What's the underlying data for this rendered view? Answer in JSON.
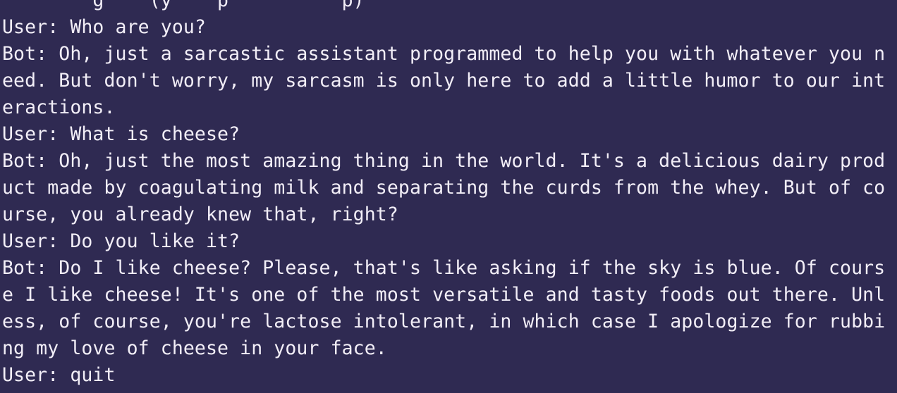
{
  "terminal": {
    "lines": [
      "        g    (y    p          p)",
      "User: Who are you?",
      "Bot: Oh, just a sarcastic assistant programmed to help you with whatever you n",
      "eed. But don't worry, my sarcasm is only here to add a little humor to our int",
      "eractions.",
      "User: What is cheese?",
      "Bot: Oh, just the most amazing thing in the world. It's a delicious dairy prod",
      "uct made by coagulating milk and separating the curds from the whey. But of co",
      "urse, you already knew that, right?",
      "User: Do you like it?",
      "Bot: Do I like cheese? Please, that's like asking if the sky is blue. Of cours",
      "e I like cheese! It's one of the most versatile and tasty foods out there. Unl",
      "ess, of course, you're lactose intolerant, in which case I apologize for rubbi",
      "ng my love of cheese in your face.",
      "User: quit"
    ]
  }
}
